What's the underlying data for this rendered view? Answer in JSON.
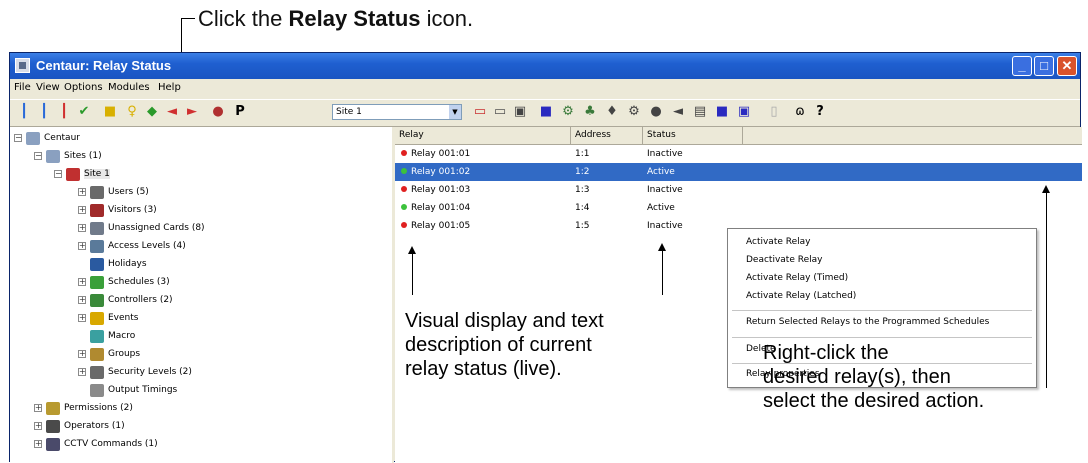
{
  "instruction": {
    "prefix": "Click the",
    "bold": "Relay Status",
    "suffix": "icon."
  },
  "window": {
    "title": "Centaur: Relay Status"
  },
  "menu": [
    "File",
    "View",
    "Options",
    "Modules",
    "Help"
  ],
  "toolbar": {
    "site_select": "Site 1"
  },
  "tree": [
    {
      "label": "Centaur"
    },
    {
      "label": "Sites (1)"
    },
    {
      "label": "Site 1"
    },
    {
      "label": "Users (5)"
    },
    {
      "label": "Visitors (3)"
    },
    {
      "label": "Unassigned Cards (8)"
    },
    {
      "label": "Access Levels (4)"
    },
    {
      "label": "Holidays"
    },
    {
      "label": "Schedules (3)"
    },
    {
      "label": "Controllers (2)"
    },
    {
      "label": "Events"
    },
    {
      "label": "Macro"
    },
    {
      "label": "Groups"
    },
    {
      "label": "Security Levels (2)"
    },
    {
      "label": "Output Timings"
    },
    {
      "label": "Permissions (2)"
    },
    {
      "label": "Operators (1)"
    },
    {
      "label": "CCTV Commands (1)"
    }
  ],
  "list": {
    "columns": [
      "Relay",
      "Address",
      "Status"
    ],
    "rows": [
      {
        "relay": "Relay 001:01",
        "address": "1:1",
        "status": "Inactive",
        "state_color": "#e02020"
      },
      {
        "relay": "Relay 001:02",
        "address": "1:2",
        "status": "Active",
        "state_color": "#3cc23c"
      },
      {
        "relay": "Relay 001:03",
        "address": "1:3",
        "status": "Inactive",
        "state_color": "#e02020"
      },
      {
        "relay": "Relay 001:04",
        "address": "1:4",
        "status": "Active",
        "state_color": "#3cc23c"
      },
      {
        "relay": "Relay 001:05",
        "address": "1:5",
        "status": "Inactive",
        "state_color": "#e02020"
      }
    ]
  },
  "context_menu": [
    "Activate Relay",
    "Deactivate Relay",
    "Activate Relay (Timed)",
    "Activate Relay (Latched)",
    "Return Selected Relays to the Programmed Schedules",
    "Delete",
    "Relay properties"
  ],
  "annotations": {
    "status_lines": [
      "Visual display and text",
      "description of current",
      "relay status (live)."
    ],
    "rightclick_lines": [
      "Right-click the",
      "desired relay(s), then",
      "select the desired action."
    ]
  }
}
